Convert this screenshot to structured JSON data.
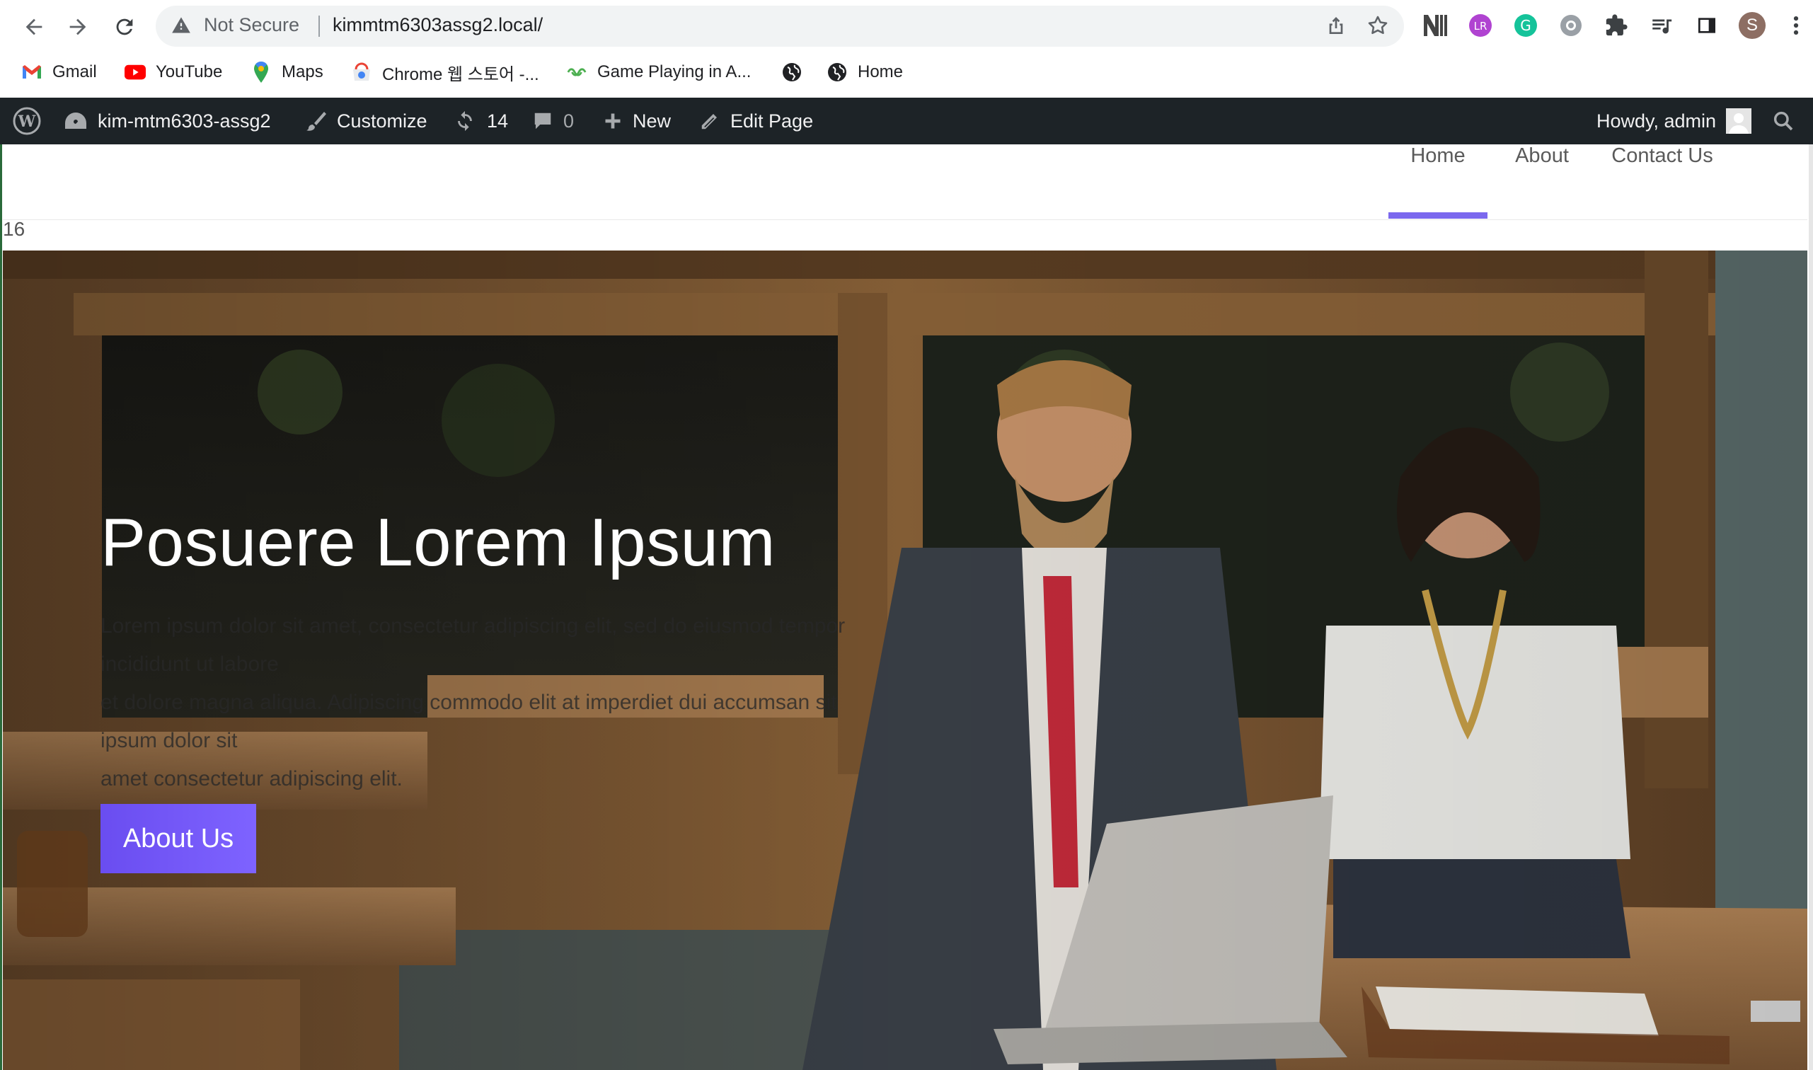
{
  "browser": {
    "security_label": "Not Secure",
    "url": "kimmtm6303assg2.local/",
    "profile_initial": "S",
    "bookmarks": [
      {
        "label": "Gmail",
        "icon": "gmail-icon"
      },
      {
        "label": "YouTube",
        "icon": "youtube-icon"
      },
      {
        "label": "Maps",
        "icon": "maps-icon"
      },
      {
        "label": "Chrome 웹 스토어 -...",
        "icon": "chrome-web-store-icon"
      },
      {
        "label": "Game Playing in A...",
        "icon": "game-icon"
      },
      {
        "label": "",
        "icon": "globe-icon"
      },
      {
        "label": "Home",
        "icon": "globe-icon"
      }
    ]
  },
  "adminbar": {
    "site_name": "kim-mtm6303-assg2",
    "customize_label": "Customize",
    "updates_count": "14",
    "comments_count": "0",
    "new_label": "New",
    "edit_label": "Edit Page",
    "howdy_label": "Howdy, admin"
  },
  "site_nav": {
    "items": [
      {
        "label": "Home"
      },
      {
        "label": "About"
      },
      {
        "label": "Contact Us"
      }
    ],
    "active_index": 0
  },
  "page": {
    "counter": "16"
  },
  "hero": {
    "title": "Posuere Lorem Ipsum",
    "lines": [
      "Lorem ipsum dolor sit amet, consectetur adipiscing elit, sed do eiusmod tempor",
      "incididunt ut labore",
      "et dolore magna aliqua. Adipiscing commodo elit at imperdiet dui accumsan sit",
      "ipsum dolor sit",
      "amet consectetur adipiscing elit."
    ],
    "button_label": "About Us"
  },
  "colors": {
    "accent": "#7b68ee",
    "adminbar": "#1d2327",
    "button": "#6f55f5"
  }
}
